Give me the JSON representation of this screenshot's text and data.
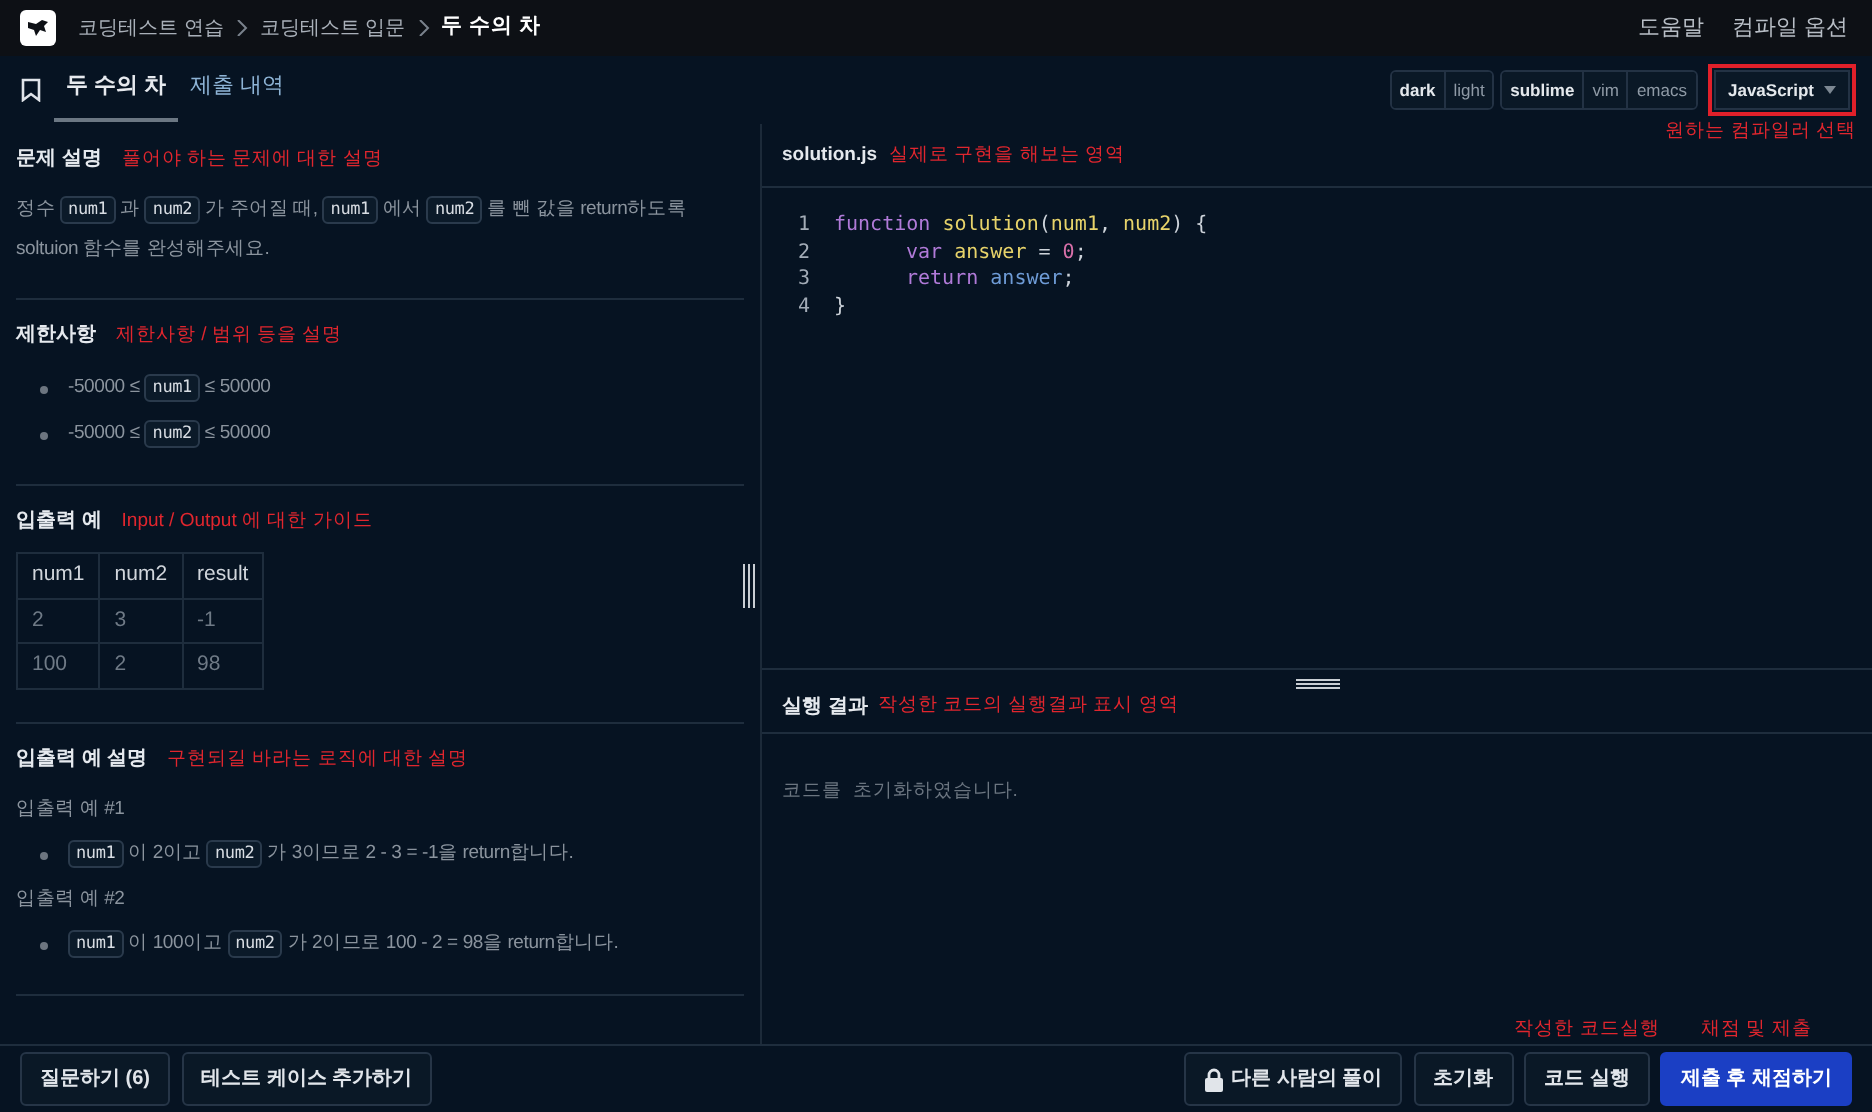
{
  "header": {
    "breadcrumbs": [
      {
        "label": "코딩테스트 연습",
        "current": false
      },
      {
        "label": "코딩테스트 입문",
        "current": false
      },
      {
        "label": "두 수의 차",
        "current": true
      }
    ],
    "links": [
      "도움말",
      "컴파일 옵션"
    ]
  },
  "tabs": [
    {
      "label": "두 수의 차",
      "selected": true
    },
    {
      "label": "제출 내역",
      "selected": false
    }
  ],
  "toolbar": {
    "themes": [
      {
        "label": "dark",
        "selected": true
      },
      {
        "label": "light",
        "selected": false
      }
    ],
    "keymaps": [
      {
        "label": "sublime",
        "selected": true
      },
      {
        "label": "vim",
        "selected": false
      },
      {
        "label": "emacs",
        "selected": false
      }
    ],
    "language": "JavaScript",
    "language_note": "원하는 컴파일러 선택"
  },
  "sections": [
    {
      "title": "문제 설명",
      "note": "풀어야 하는 문제에 대한 설명",
      "blocks": [
        {
          "kind": "para",
          "segments": [
            {
              "kind": "text",
              "text": "정수 "
            },
            {
              "kind": "code",
              "text": "num1"
            },
            {
              "kind": "text",
              "text": " 과 "
            },
            {
              "kind": "code",
              "text": "num2"
            },
            {
              "kind": "text",
              "text": " 가 주어질 때, "
            },
            {
              "kind": "code",
              "text": "num1"
            },
            {
              "kind": "text",
              "text": " 에서 "
            },
            {
              "kind": "code",
              "text": "num2"
            },
            {
              "kind": "text",
              "text": " 를 뺀 값을 return하도록 soltuion 함수를 완성해주세요."
            }
          ]
        }
      ]
    },
    {
      "title": "제한사항",
      "note": "제한사항 / 범위 등을 설명",
      "blocks": [
        {
          "kind": "bullet",
          "segments": [
            {
              "kind": "text",
              "text": "-50000 ≤ "
            },
            {
              "kind": "code",
              "text": "num1"
            },
            {
              "kind": "text",
              "text": " ≤ 50000"
            }
          ]
        },
        {
          "kind": "bullet",
          "segments": [
            {
              "kind": "text",
              "text": "-50000 ≤ "
            },
            {
              "kind": "code",
              "text": "num2"
            },
            {
              "kind": "text",
              "text": " ≤ 50000"
            }
          ]
        }
      ]
    },
    {
      "title": "입출력 예",
      "note": "Input / Output 에 대한 가이드",
      "blocks": [
        {
          "kind": "table",
          "columns": [
            "num1",
            "num2",
            "result"
          ],
          "rows": [
            [
              "2",
              "3",
              "-1"
            ],
            [
              "100",
              "2",
              "98"
            ]
          ]
        }
      ]
    },
    {
      "title": "입출력 예 설명",
      "note": "구현되길 바라는 로직에 대한 설명",
      "blocks": [
        {
          "kind": "para",
          "segments": [
            {
              "kind": "text",
              "text": "입출력 예 #1"
            }
          ]
        },
        {
          "kind": "bullet",
          "segments": [
            {
              "kind": "code",
              "text": "num1"
            },
            {
              "kind": "text",
              "text": " 이 2이고 "
            },
            {
              "kind": "code",
              "text": "num2"
            },
            {
              "kind": "text",
              "text": " 가 3이므로 2 - 3 = -1을 return합니다."
            }
          ]
        },
        {
          "kind": "para",
          "segments": [
            {
              "kind": "text",
              "text": "입출력 예 #2"
            }
          ]
        },
        {
          "kind": "bullet",
          "segments": [
            {
              "kind": "code",
              "text": "num1"
            },
            {
              "kind": "text",
              "text": " 이 100이고 "
            },
            {
              "kind": "code",
              "text": "num2"
            },
            {
              "kind": "text",
              "text": " 가 2이므로 100 - 2 = 98을 return합니다."
            }
          ]
        }
      ]
    }
  ],
  "editor": {
    "filename": "solution.js",
    "note": "실제로 구현을 해보는 영역",
    "lines": [
      {
        "number": "1",
        "indented": false,
        "tokens": [
          {
            "kind": "keyword",
            "text": "function "
          },
          {
            "kind": "name",
            "text": "solution"
          },
          {
            "kind": "punct",
            "text": "("
          },
          {
            "kind": "name",
            "text": "num1"
          },
          {
            "kind": "punct",
            "text": ", "
          },
          {
            "kind": "name",
            "text": "num2"
          },
          {
            "kind": "punct",
            "text": ") {"
          }
        ]
      },
      {
        "number": "2",
        "indented": true,
        "tokens": [
          {
            "kind": "keyword",
            "text": "var "
          },
          {
            "kind": "name",
            "text": "answer"
          },
          {
            "kind": "punct",
            "text": " = "
          },
          {
            "kind": "number",
            "text": "0"
          },
          {
            "kind": "punct",
            "text": ";"
          }
        ]
      },
      {
        "number": "3",
        "indented": true,
        "tokens": [
          {
            "kind": "keyword",
            "text": "return "
          },
          {
            "kind": "variable",
            "text": "answer"
          },
          {
            "kind": "punct",
            "text": ";"
          }
        ]
      },
      {
        "number": "4",
        "indented": false,
        "tokens": [
          {
            "kind": "punct",
            "text": "}"
          }
        ]
      }
    ]
  },
  "output": {
    "title": "실행 결과",
    "note": "작성한 코드의 실행결과 표시 영역",
    "message": "코드를  초기화하였습니다."
  },
  "footer": {
    "left_buttons": [
      "질문하기 (6)",
      "테스트 케이스 추가하기"
    ],
    "right_buttons": [
      {
        "kind": "locked",
        "label": "다른 사람의 풀이"
      },
      {
        "kind": "plain",
        "label": "초기화"
      },
      {
        "kind": "plain",
        "label": "코드 실행",
        "note": "작성한 코드실행"
      },
      {
        "kind": "primary",
        "label": "제출 후 채점하기",
        "note": "채점 및 제출"
      }
    ]
  }
}
